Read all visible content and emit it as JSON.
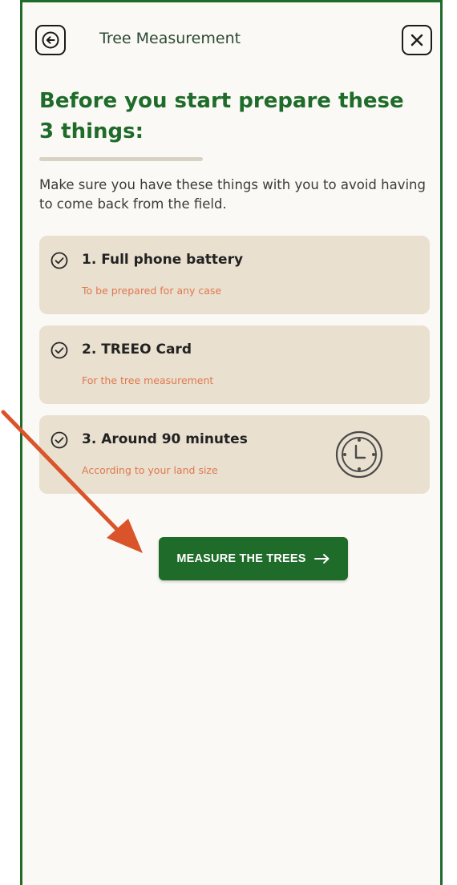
{
  "header": {
    "title": "Tree Measurement",
    "back_icon": "arrow-left-icon",
    "close_icon": "close-icon"
  },
  "main": {
    "heading": "Before you start prepare these 3 things:",
    "intro": "Make sure you have these things with you to avoid having to come back from the field.",
    "items": [
      {
        "title": "1. Full phone battery",
        "subtitle": "To be prepared for any case",
        "icon": "check-circle-icon"
      },
      {
        "title": "2. TREEO Card",
        "subtitle": "For the tree measurement",
        "icon": "check-circle-icon"
      },
      {
        "title": "3. Around 90 minutes",
        "subtitle": "According to your land size",
        "icon": "check-circle-icon",
        "extra_icon": "clock-icon"
      }
    ],
    "cta_label": "MEASURE THE TREES",
    "cta_icon": "arrow-right-icon"
  },
  "colors": {
    "brand_green": "#1e6b2a",
    "card_bg": "#e9e0d0",
    "subtitle_orange": "#e0784e",
    "annotation_arrow": "#d9542a"
  }
}
